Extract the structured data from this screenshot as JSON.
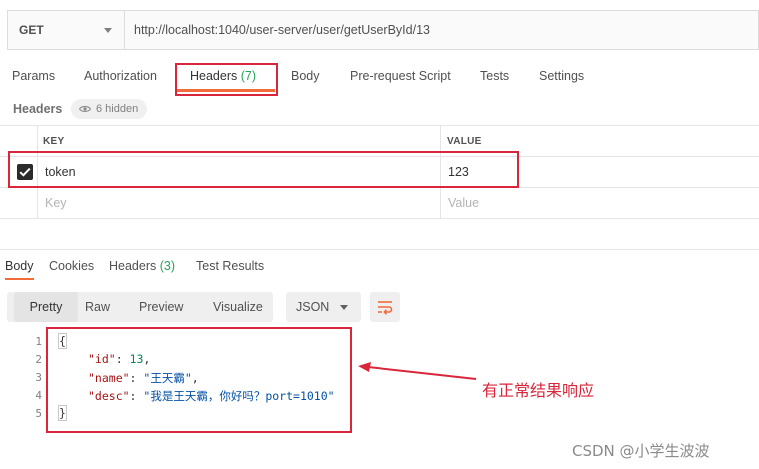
{
  "request": {
    "method": "GET",
    "url": "http://localhost:1040/user-server/user/getUserById/13"
  },
  "request_tabs": [
    {
      "label": "Params",
      "count": ""
    },
    {
      "label": "Authorization",
      "count": ""
    },
    {
      "label": "Headers",
      "count": "(7)"
    },
    {
      "label": "Body",
      "count": ""
    },
    {
      "label": "Pre-request Script",
      "count": ""
    },
    {
      "label": "Tests",
      "count": ""
    },
    {
      "label": "Settings",
      "count": ""
    }
  ],
  "headers_section": {
    "title": "Headers",
    "hidden_label": "6 hidden",
    "columns": [
      "KEY",
      "VALUE"
    ],
    "rows": [
      {
        "checked": true,
        "key": "token",
        "value": "123"
      }
    ],
    "placeholder_key": "Key",
    "placeholder_value": "Value"
  },
  "response_tabs": [
    {
      "label": "Body",
      "count": ""
    },
    {
      "label": "Cookies",
      "count": ""
    },
    {
      "label": "Headers",
      "count": "(3)"
    },
    {
      "label": "Test Results",
      "count": ""
    }
  ],
  "view_modes": [
    "Pretty",
    "Raw",
    "Preview",
    "Visualize"
  ],
  "format_select": "JSON",
  "response_body": {
    "line_numbers": [
      "1",
      "2",
      "3",
      "4",
      "5"
    ],
    "open_brace": "{",
    "close_brace": "}",
    "fields": [
      {
        "key": "\"id\"",
        "value": "13",
        "type": "number",
        "trail": ","
      },
      {
        "key": "\"name\"",
        "value": "\"王天霸\"",
        "type": "string",
        "trail": ","
      },
      {
        "key": "\"desc\"",
        "value": "\"我是王天霸，你好吗？port=1010\"",
        "type": "string",
        "trail": ""
      }
    ]
  },
  "annotation_text": "有正常结果响应",
  "watermark": "CSDN @小学生波波",
  "colors": {
    "accent_orange": "#f26b3a",
    "count_green": "#26a35a",
    "annotation_red": "#d9263b"
  }
}
